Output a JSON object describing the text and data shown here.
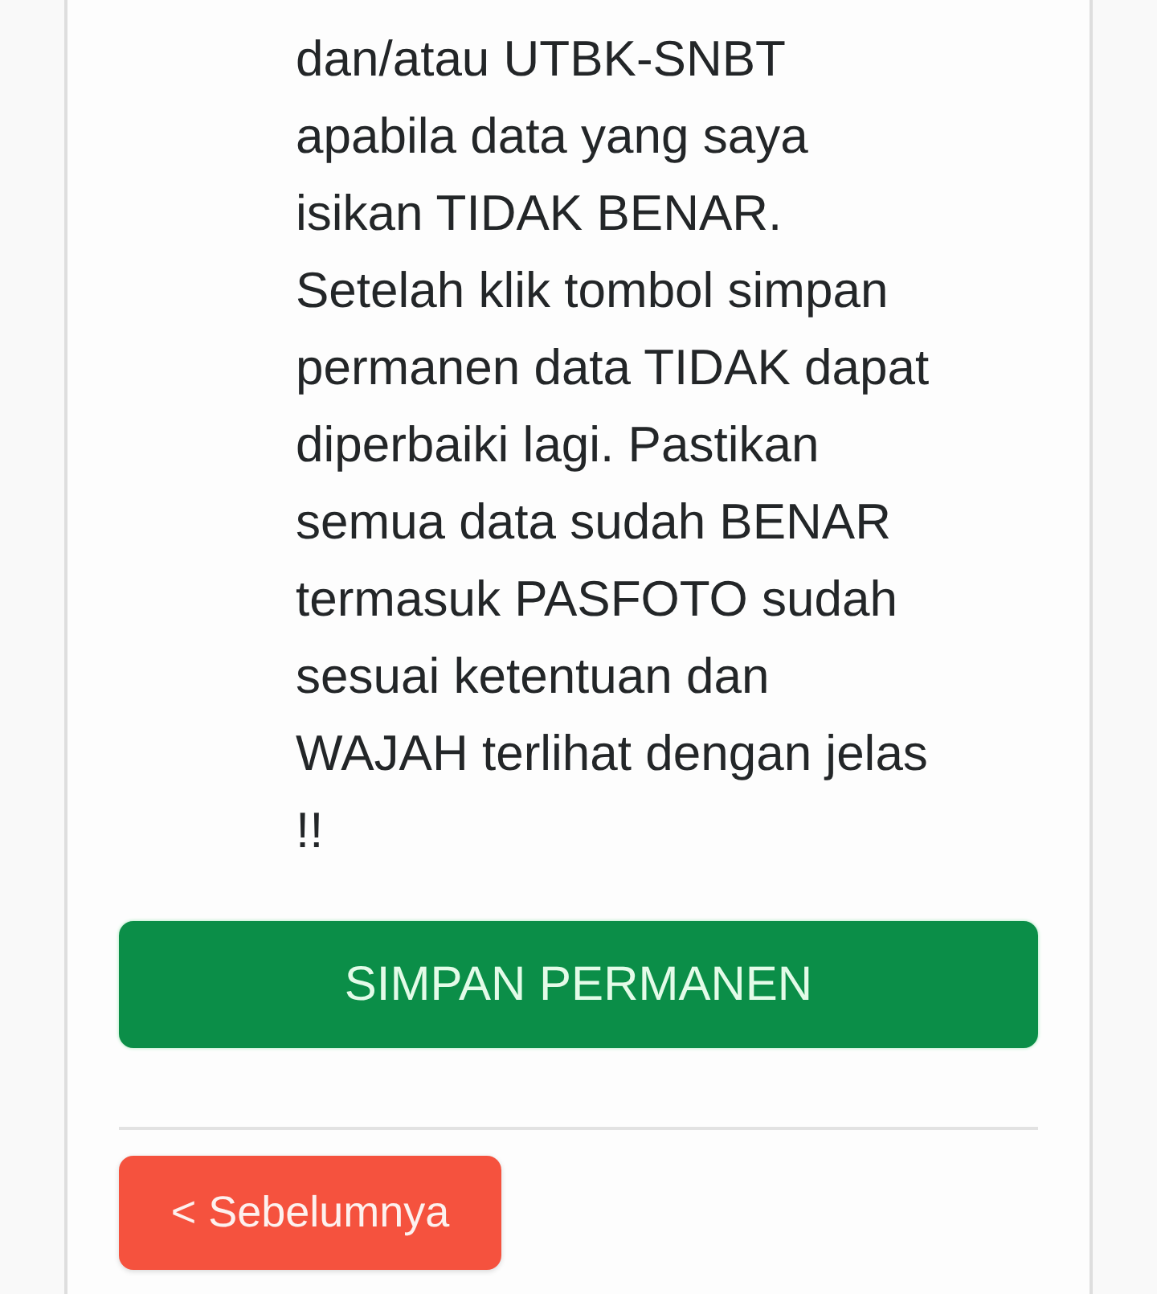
{
  "notice": {
    "paragraphs": [
      "dan/atau UTBK-SNBT apabila data yang saya isikan TIDAK BENAR.",
      "Setelah klik tombol simpan permanen data TIDAK dapat diperbaiki lagi. Pastikan semua data sudah BENAR termasuk PASFOTO sudah sesuai ketentuan dan WAJAH terlihat dengan jelas !!"
    ]
  },
  "save_button": {
    "label": "SIMPAN PERMANEN"
  },
  "back_button": {
    "label": "< Sebelumnya"
  }
}
